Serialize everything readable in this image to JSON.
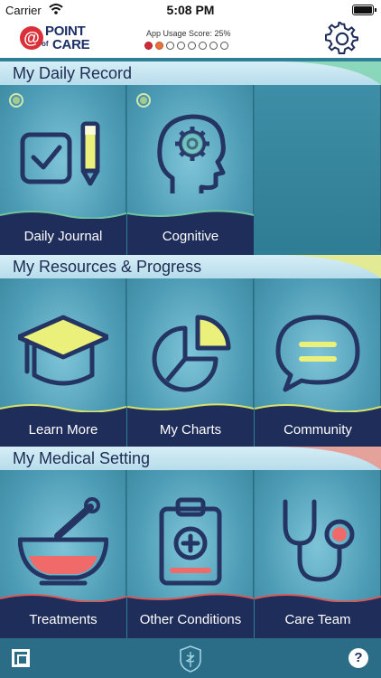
{
  "status_bar": {
    "carrier": "Carrier",
    "time": "5:08 PM"
  },
  "header": {
    "logo": {
      "symbol": "@",
      "word_top": "POINT",
      "word_of": "of",
      "word_bottom": "CARE"
    },
    "usage_score_label": "App Usage Score: 25%",
    "usage_score_fraction": 0.25,
    "usage_dots": [
      "red",
      "orange",
      "empty",
      "empty",
      "empty",
      "empty",
      "empty",
      "empty"
    ]
  },
  "sections": [
    {
      "title": "My Daily Record",
      "accent": "#7fd4b0"
    },
    {
      "title": "My Resources & Progress",
      "accent": "#e6ea8a"
    },
    {
      "title": "My Medical Setting",
      "accent": "#e79a90"
    }
  ],
  "tiles": {
    "daily_journal": "Daily Journal",
    "cognitive": "Cognitive",
    "learn_more": "Learn More",
    "my_charts": "My Charts",
    "community": "Community",
    "treatments": "Treatments",
    "other_conditions": "Other Conditions",
    "care_team": "Care Team"
  },
  "bottom_bar": {
    "help_label": "?"
  },
  "colors": {
    "navy": "#1f2d5a",
    "icon_line": "#2a3a6a",
    "yellow": "#eaf07a",
    "salmon": "#f06a6a",
    "green_wave": "#6fc4a0",
    "yellow_wave": "#d9e26a",
    "red_wave": "#d45a5a"
  }
}
